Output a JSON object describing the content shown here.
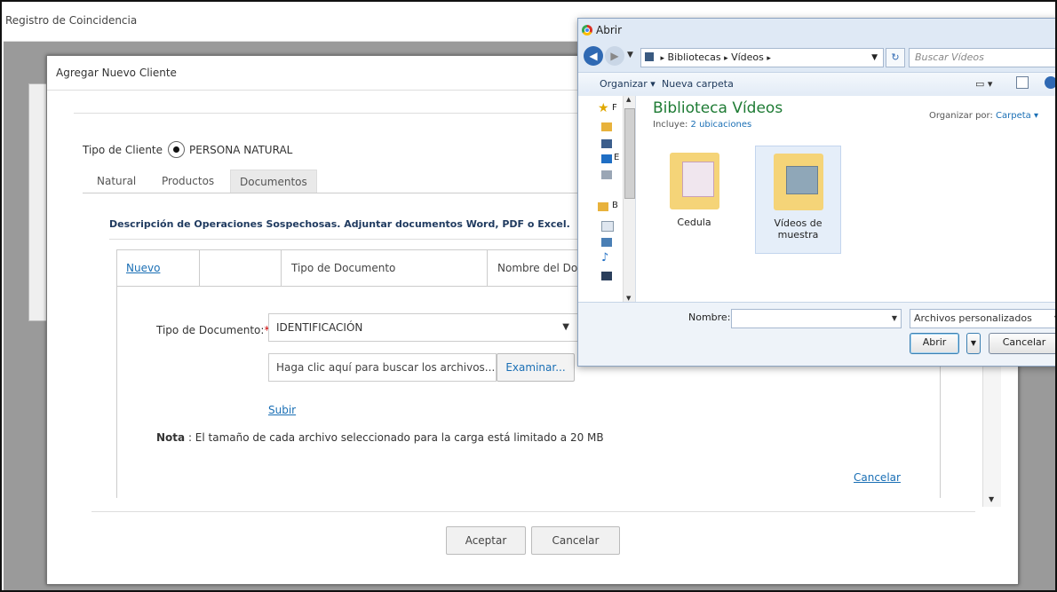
{
  "outer": {
    "title": "Registro de Coincidencia"
  },
  "modal": {
    "title": "Agregar Nuevo Cliente",
    "client_type_label": "Tipo de Cliente",
    "client_type_value": "PERSONA NATURAL",
    "tabs": [
      {
        "label": "Natural"
      },
      {
        "label": "Productos"
      },
      {
        "label": "Documentos"
      }
    ],
    "description": "Descripción de Operaciones Sospechosas. Adjuntar documentos Word, PDF o Excel.",
    "table_headers": {
      "new": "Nuevo",
      "doc_type": "Tipo de Documento",
      "doc_name": "Nombre del Doc"
    },
    "form": {
      "doc_type_label": "Tipo de Documento:",
      "required_mark": "*",
      "doc_type_value": "IDENTIFICACIÓN",
      "file_placeholder": "Haga clic aquí para buscar los archivos...",
      "browse_label": "Examinar...",
      "upload_label": "Subir",
      "note_bold": "Nota",
      "note_text": " : El tamaño de cada archivo seleccionado para la carga está limitado a 20 MB",
      "cancel_link": "Cancelar"
    },
    "footer": {
      "accept_label": "Aceptar",
      "cancel_label": "Cancelar"
    }
  },
  "dialog": {
    "title": "Abrir",
    "breadcrumb": [
      "Bibliotecas",
      "Vídeos"
    ],
    "search_placeholder": "Buscar Vídeos",
    "toolbar": {
      "organize": "Organizar",
      "new_folder": "Nueva carpeta"
    },
    "library_title": "Biblioteca Vídeos",
    "includes_label": "Incluye:",
    "includes_value": "2 ubicaciones",
    "arrange_label": "Organizar por:",
    "arrange_value": "Carpeta",
    "nav_labels": [
      "F",
      "E",
      "B"
    ],
    "folders": [
      {
        "name": "Cedula"
      },
      {
        "name": "Vídeos de muestra"
      }
    ],
    "filename_label": "Nombre:",
    "filter_value": "Archivos personalizados",
    "open_label": "Abrir",
    "cancel_label": "Cancelar"
  }
}
